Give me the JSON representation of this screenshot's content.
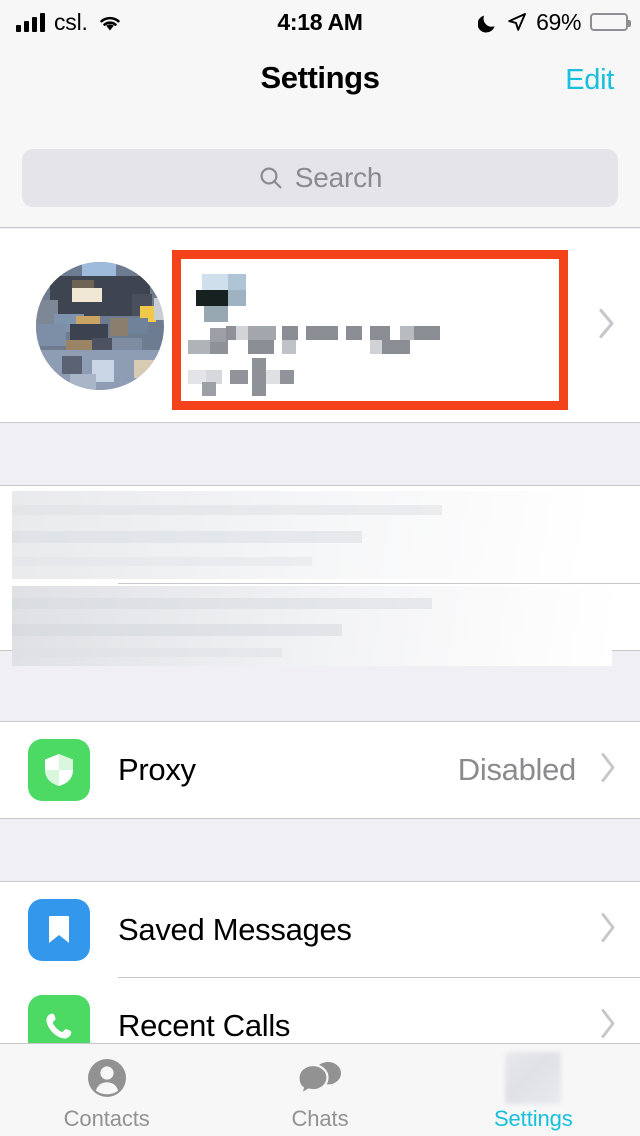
{
  "status_bar": {
    "carrier": "csl.",
    "time": "4:18 AM",
    "battery_percent": "69%",
    "signal_icon": "cellular-bars-icon",
    "wifi_icon": "wifi-icon",
    "dnd_icon": "moon-icon",
    "location_icon": "location-arrow-icon",
    "battery_icon": "battery-icon",
    "battery_color": "#FFCC00"
  },
  "nav": {
    "title": "Settings",
    "edit_label": "Edit",
    "accent_color": "#17C0DB"
  },
  "search": {
    "placeholder": "Search",
    "icon": "search-icon"
  },
  "profile": {
    "avatar_icon": "user-avatar-pixelated",
    "name_redacted": true,
    "phone_redacted": true,
    "username_redacted": true,
    "highlight_color": "#F4421B",
    "chevron_icon": "chevron-right-icon"
  },
  "redacted_group": {
    "rows": [
      {
        "name": "redacted-row-1"
      },
      {
        "name": "redacted-row-2"
      }
    ]
  },
  "sections": [
    {
      "rows": [
        {
          "label": "Proxy",
          "value": "Disabled",
          "icon": "shield-icon",
          "icon_color": "#4CD964",
          "chevron": "chevron-right-icon"
        }
      ]
    },
    {
      "rows": [
        {
          "label": "Saved Messages",
          "value": "",
          "icon": "bookmark-icon",
          "icon_color": "#3398EC",
          "chevron": "chevron-right-icon"
        },
        {
          "label": "Recent Calls",
          "value": "",
          "icon": "phone-icon",
          "icon_color": "#4CD964",
          "chevron": "chevron-right-icon"
        }
      ]
    }
  ],
  "tabbar": {
    "tabs": [
      {
        "label": "Contacts",
        "icon": "contacts-person-icon",
        "active": false
      },
      {
        "label": "Chats",
        "icon": "chats-bubbles-icon",
        "active": false
      },
      {
        "label": "Settings",
        "icon": "settings-gear-icon-blurred",
        "active": true
      }
    ],
    "active_color": "#17C0DB",
    "inactive_color": "#929292"
  }
}
